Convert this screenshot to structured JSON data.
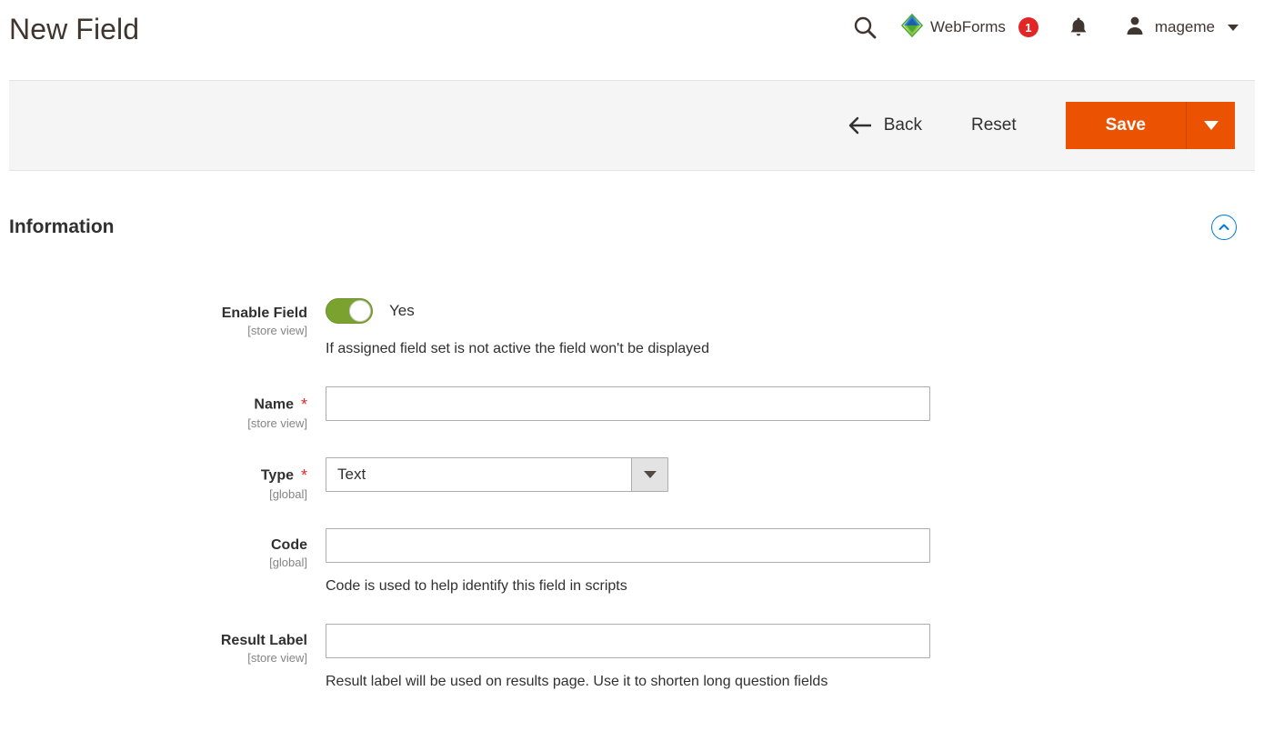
{
  "header": {
    "title": "New Field",
    "search_icon": "search-icon",
    "webforms": {
      "logo_icon": "webforms-logo-icon",
      "label": "WebForms",
      "badge_count": "1",
      "badge_color": "#e22626"
    },
    "notifications_icon": "bell-icon",
    "user": {
      "avatar_icon": "user-avatar-icon",
      "name": "mageme",
      "caret_icon": "chevron-down-icon"
    }
  },
  "toolbar": {
    "back_label": "Back",
    "back_icon": "arrow-left-icon",
    "reset_label": "Reset",
    "save_label": "Save",
    "save_menu_icon": "chevron-down-icon",
    "accent_color": "#eb5202"
  },
  "section": {
    "title": "Information",
    "collapse_icon": "chevron-up-circle-icon",
    "collapse_color": "#007bdb"
  },
  "form": {
    "fields": [
      {
        "label": "Enable Field",
        "scope": "[store view]",
        "required": false,
        "control": "toggle",
        "toggle_state": "Yes",
        "toggle_color": "#79a22e",
        "note": "If assigned field set is not active the field won't be displayed"
      },
      {
        "label": "Name",
        "scope": "[store view]",
        "required": true,
        "control": "text",
        "value": "",
        "placeholder": "",
        "note": ""
      },
      {
        "label": "Type",
        "scope": "[global]",
        "required": true,
        "control": "select",
        "value": "Text",
        "note": ""
      },
      {
        "label": "Code",
        "scope": "[global]",
        "required": false,
        "control": "text",
        "value": "",
        "placeholder": "",
        "note": "Code is used to help identify this field in scripts"
      },
      {
        "label": "Result Label",
        "scope": "[store view]",
        "required": false,
        "control": "text",
        "value": "",
        "placeholder": "",
        "note": "Result label will be used on results page. Use it to shorten long question fields"
      }
    ]
  }
}
